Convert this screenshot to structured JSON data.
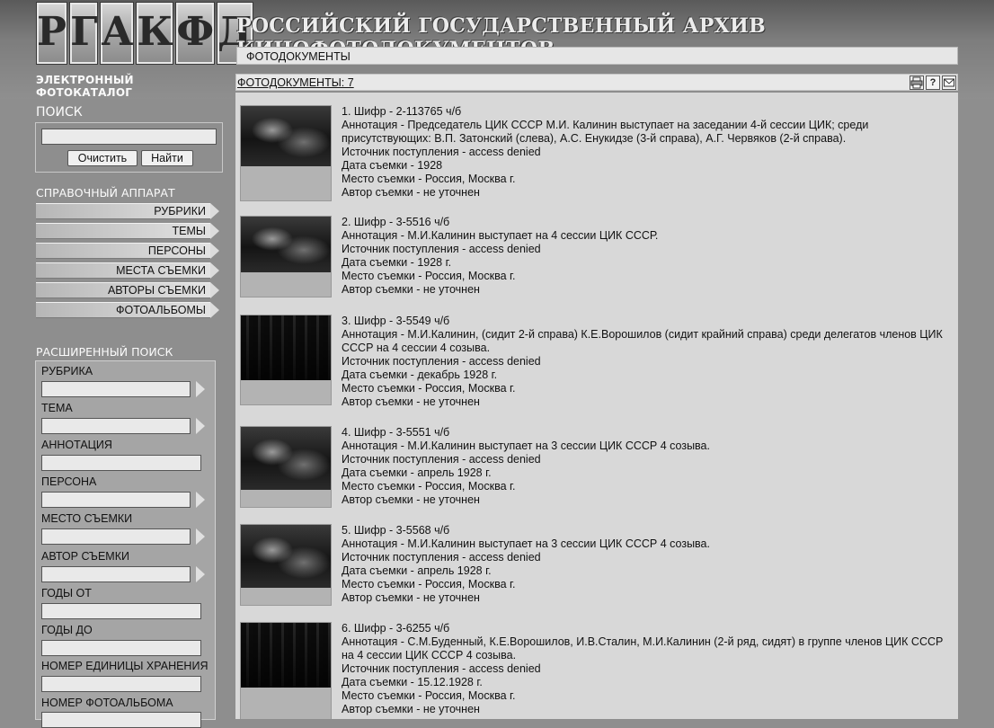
{
  "header": {
    "logo_letters": [
      "Р",
      "Г",
      "А",
      "К",
      "Ф",
      "Д"
    ],
    "logo_caption": "ЭЛЕКТРОННЫЙ ФОТОКАТАЛОГ",
    "site_title": "РОССИЙСКИЙ ГОСУДАРСТВЕННЫЙ АРХИВ КИНОФОТОДОКУМЕНТОВ",
    "section": "ФОТОДОКУМЕНТЫ"
  },
  "search": {
    "heading": "ПОИСК",
    "value": "",
    "clear_label": "Очистить",
    "find_label": "Найти"
  },
  "reference": {
    "heading": "СПРАВОЧНЫЙ АППАРАТ",
    "items": [
      "РУБРИКИ",
      "ТЕМЫ",
      "ПЕРСОНЫ",
      "МЕСТА СЪЕМКИ",
      "АВТОРЫ СЪЕМКИ",
      "ФОТОАЛЬБОМЫ"
    ]
  },
  "advanced": {
    "heading": "РАСШИРЕННЫЙ ПОИСК",
    "fields": [
      {
        "label": "РУБРИКА",
        "lookup": true
      },
      {
        "label": "ТЕМА",
        "lookup": true
      },
      {
        "label": "АННОТАЦИЯ",
        "lookup": false
      },
      {
        "label": "ПЕРСОНА",
        "lookup": true
      },
      {
        "label": "МЕСТО СЪЕМКИ",
        "lookup": true
      },
      {
        "label": "АВТОР СЪЕМКИ",
        "lookup": true
      },
      {
        "label": "ГОДЫ ОТ",
        "lookup": false
      },
      {
        "label": "ГОДЫ ДО",
        "lookup": false
      },
      {
        "label": "НОМЕР ЕДИНИЦЫ ХРАНЕНИЯ",
        "lookup": false
      },
      {
        "label": "НОМЕР ФОТОАЛЬБОМА",
        "lookup": false
      }
    ]
  },
  "results": {
    "count_label": "ФОТОДОКУМЕНТЫ: 7",
    "tools": {
      "print": "print-icon",
      "help": "?",
      "mail": "mail-icon"
    },
    "records": [
      {
        "cipher_line": "1. Шифр  -  2-113765 ч/б",
        "annotation_line": "Аннотация  -  Председатель ЦИК СССР М.И. Калинин выступает на заседании 4-й сессии ЦИК; среди присутствующих: В.П. Затонский (слева), А.С. Енукидзе (3-й справа), А.Г. Червяков (2-й справа).",
        "source_line": "Источник поступления  -  access denied",
        "date_line": "Дата съемки  -  1928",
        "place_line": "Место съемки  -  Россия, Москва г.",
        "author_line": "Автор съемки  -  не уточнен"
      },
      {
        "cipher_line": "2. Шифр  -  3-5516 ч/б",
        "annotation_line": "Аннотация  -  М.И.Калинин выступает на 4 сессии ЦИК СССР.",
        "source_line": "Источник поступления  -  access denied",
        "date_line": "Дата съемки  -  1928 г.",
        "place_line": "Место съемки  -  Россия, Москва г.",
        "author_line": "Автор съемки  -  не уточнен"
      },
      {
        "cipher_line": "3. Шифр  -  3-5549 ч/б",
        "annotation_line": "Аннотация  -  М.И.Калинин, (сидит 2-й справа) К.Е.Ворошилов (сидит крайний справа) среди делегатов членов ЦИК СССР на 4 сессии 4 созыва.",
        "source_line": "Источник поступления  -  access denied",
        "date_line": "Дата съемки  -  декабрь 1928 г.",
        "place_line": "Место съемки  -  Россия, Москва г.",
        "author_line": "Автор съемки  -  не уточнен"
      },
      {
        "cipher_line": "4. Шифр  -  3-5551 ч/б",
        "annotation_line": "Аннотация  -  М.И.Калинин выступает на 3 сессии ЦИК СССР 4 созыва.",
        "source_line": "Источник поступления  -  access denied",
        "date_line": "Дата съемки  -  апрель 1928 г.",
        "place_line": "Место съемки  -  Россия, Москва г.",
        "author_line": "Автор съемки  -  не уточнен"
      },
      {
        "cipher_line": "5. Шифр  -  3-5568 ч/б",
        "annotation_line": "Аннотация  -  М.И.Калинин выступает на 3 сессии ЦИК СССР 4 созыва.",
        "source_line": "Источник поступления  -  access denied",
        "date_line": "Дата съемки  -  апрель 1928 г.",
        "place_line": "Место съемки  -  Россия, Москва г.",
        "author_line": "Автор съемки  -  не уточнен"
      },
      {
        "cipher_line": "6. Шифр  -  3-6255 ч/б",
        "annotation_line": "Аннотация  -  С.М.Буденный, К.Е.Ворошилов, И.В.Сталин, М.И.Калинин (2-й ряд, сидят) в группе членов ЦИК СССР на 4 сессии ЦИК СССР 4 созыва.",
        "source_line": "Источник поступления  -  access denied",
        "date_line": "Дата съемки  -  15.12.1928 г.",
        "place_line": "Место съемки  -  Россия, Москва г.",
        "author_line": "Автор съемки  -  не уточнен"
      }
    ]
  }
}
